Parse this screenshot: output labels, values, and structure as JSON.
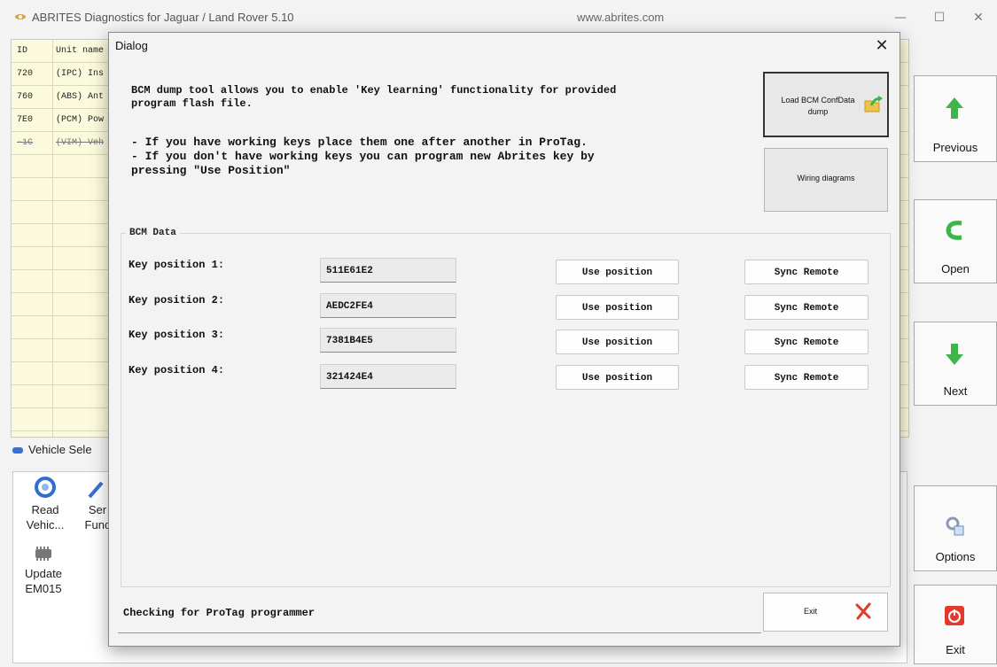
{
  "window": {
    "title": "ABRITES Diagnostics for Jaguar / Land Rover 5.10",
    "url": "www.abrites.com",
    "minimize": "—",
    "maximize": "☐",
    "close": "✕"
  },
  "units_table": {
    "headers": [
      "ID",
      "Unit name"
    ],
    "rows": [
      {
        "id": "720",
        "name": "(IPC) Ins"
      },
      {
        "id": "760",
        "name": "(ABS) Ant"
      },
      {
        "id": "7E0",
        "name": "(PCM) Pow"
      },
      {
        "id": "-1C",
        "name": "(VIM) Veh"
      }
    ]
  },
  "vehicle_section": {
    "title": "Vehicle Sele",
    "items": [
      {
        "line1": "Read",
        "line2": "Vehic..."
      },
      {
        "line1": "Ser",
        "line2": "Func"
      },
      {
        "line1": "Update",
        "line2": "EM015"
      }
    ]
  },
  "side_buttons": {
    "previous": "Previous",
    "open": "Open",
    "next": "Next",
    "options": "Options",
    "exit": "Exit"
  },
  "dialog": {
    "title": "Dialog",
    "close": "✕",
    "description": "BCM dump tool allows you to enable 'Key learning' functionality for provided\nprogram flash file.",
    "bullets": "- If you have working keys place them one after another in ProTag.\n- If you don't have working keys you can program new Abrites key by\npressing \"Use Position\"",
    "load_button": "Load BCM ConfData dump",
    "wiring_button": "Wiring diagrams",
    "group_title": "BCM Data",
    "keys": [
      {
        "label": "Key position 1:",
        "value": "511E61E2",
        "use": "Use position",
        "sync": "Sync Remote"
      },
      {
        "label": "Key position 2:",
        "value": "AEDC2FE4",
        "use": "Use position",
        "sync": "Sync Remote"
      },
      {
        "label": "Key position 3:",
        "value": "7381B4E5",
        "use": "Use position",
        "sync": "Sync Remote"
      },
      {
        "label": "Key position 4:",
        "value": "321424E4",
        "use": "Use position",
        "sync": "Sync Remote"
      }
    ],
    "status": "Checking for ProTag programmer",
    "exit_button": "Exit"
  }
}
